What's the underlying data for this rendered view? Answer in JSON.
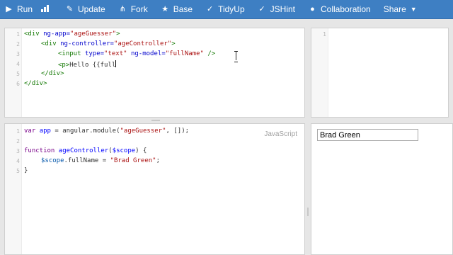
{
  "toolbar": {
    "buttons": [
      {
        "label": "Run",
        "icon": "play-icon"
      },
      {
        "label": "Update",
        "icon": "pencil-icon"
      },
      {
        "label": "Fork",
        "icon": "fork-icon"
      },
      {
        "label": "Base",
        "icon": "star-icon"
      },
      {
        "label": "TidyUp",
        "icon": "check-icon"
      },
      {
        "label": "JSHint",
        "icon": "check-icon"
      },
      {
        "label": "Collaboration",
        "icon": "users-icon"
      },
      {
        "label": "Share",
        "icon": "caret-down-icon"
      }
    ],
    "chart_icon": "bar-chart-icon",
    "colors": {
      "bar": "#3e7fc3",
      "text": "#ffffff"
    }
  },
  "html_pane": {
    "line_numbers": [
      "1",
      "2",
      "3",
      "4",
      "5",
      "6"
    ],
    "lines": [
      [
        "<div ",
        "ng-app=",
        "\"ageGuesser\"",
        ">"
      ],
      [
        "<div ",
        "ng-controller=",
        "\"ageController\"",
        ">"
      ],
      [
        "<input ",
        "type=",
        "\"text\"",
        " ng-model=",
        "\"fullName\"",
        " />"
      ],
      [
        "<p>",
        "Hello {{full"
      ],
      [
        "</div>"
      ],
      [
        "</div>"
      ]
    ]
  },
  "css_pane": {
    "line_numbers": [
      "1"
    ]
  },
  "js_pane": {
    "label": "JavaScript",
    "line_numbers": [
      "1",
      "2",
      "3",
      "4",
      "5"
    ],
    "line1": [
      "var ",
      "app",
      " = angular.module(",
      "\"ageGuesser\"",
      ", []);"
    ],
    "line3": [
      "function ",
      "ageController",
      "(",
      "$scope",
      ") {"
    ],
    "line4": [
      "$scope",
      ".fullName = ",
      "\"Brad Green\"",
      ";"
    ],
    "line5": "}"
  },
  "result_pane": {
    "input_value": "Brad Green"
  }
}
